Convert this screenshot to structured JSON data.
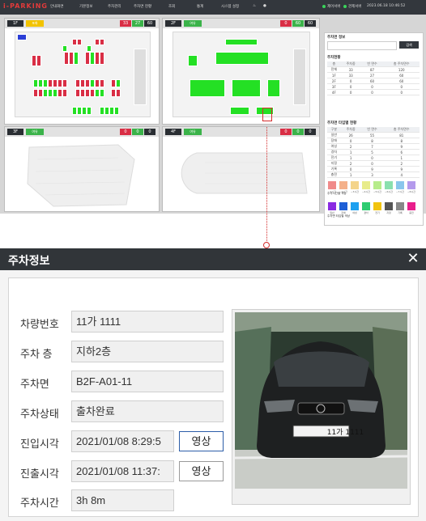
{
  "app": {
    "logo": "i-PARKING"
  },
  "menu": [
    "안내화면",
    "기본정보",
    "주차관리",
    "주차면 현황",
    "조회",
    "통계",
    "시스템 설정"
  ],
  "indicators": [
    "제어서버",
    "관제서버"
  ],
  "datetime": "2023.06.18 10:46:52",
  "floors": [
    {
      "label": "1F",
      "status": "포화",
      "status_color": "#f2c300",
      "counts": [
        "33",
        "27",
        "60"
      ]
    },
    {
      "label": "2F",
      "status": "여유",
      "status_color": "#3bb34a",
      "counts": [
        "0",
        "60",
        "60"
      ]
    },
    {
      "label": "3F",
      "status": "여유",
      "status_color": "#3bb34a",
      "counts": [
        "0",
        "0",
        "0"
      ]
    },
    {
      "label": "4F",
      "status": "여유",
      "status_color": "#3bb34a",
      "counts": [
        "0",
        "0",
        "0"
      ]
    }
  ],
  "side_panel": {
    "section1_title": "주차면 정보",
    "search_button": "검색",
    "section2_title": "주차현황",
    "status_table": {
      "headers": [
        "층",
        "주차중",
        "빈 면수",
        "총 주차면수"
      ],
      "rows": [
        [
          "전체",
          "33",
          "87",
          "120"
        ],
        [
          "1F",
          "33",
          "27",
          "60"
        ],
        [
          "2F",
          "0",
          "60",
          "60"
        ],
        [
          "3F",
          "0",
          "0",
          "0"
        ],
        [
          "4F",
          "0",
          "0",
          "0"
        ]
      ]
    },
    "section3_title": "주차면 타입별 현황",
    "type_table": {
      "headers": [
        "구분",
        "주차중",
        "빈 면수",
        "총 주차면수"
      ],
      "rows": [
        [
          "일반",
          "26",
          "55",
          "81"
        ],
        [
          "장애",
          "0",
          "8",
          "8"
        ],
        [
          "여성",
          "2",
          "7",
          "9"
        ],
        [
          "경차",
          "1",
          "5",
          "6"
        ],
        [
          "전기",
          "1",
          "0",
          "1"
        ],
        [
          "지정",
          "2",
          "0",
          "2"
        ],
        [
          "기록",
          "0",
          "9",
          "9"
        ],
        [
          "충전",
          "1",
          "3",
          "4"
        ]
      ]
    },
    "legend1_title": "주차시간별 색상",
    "legend1_colors": [
      "#f08a8a",
      "#f4b08a",
      "#f4d48a",
      "#e8ec8a",
      "#b6ec8a",
      "#8ae0ae",
      "#8ac6ec",
      "#b49aec"
    ],
    "legend1_labels": [
      "~1시간",
      "~2시간",
      "~3시간",
      "~4시간",
      "~5시간",
      "~6시간",
      "~7시간",
      "~8시간"
    ],
    "legend2_title": "주차면 타입별 색상",
    "legend2_colors": [
      "#8a2be2",
      "#1e5fd6",
      "#1ea0f0",
      "#2ecc71",
      "#f1c40f",
      "#555555",
      "#888888",
      "#e91e8c"
    ],
    "legend2_labels": [
      "일반",
      "장애",
      "여성",
      "경차",
      "전기",
      "지정",
      "기록",
      "충전"
    ]
  },
  "modal": {
    "title": "주차정보",
    "close_icon": "close-icon",
    "fields": {
      "plate_label": "차량번호",
      "plate_value": "11가 1111",
      "floor_label": "주차 층",
      "floor_value": "지하2층",
      "slot_label": "주차면",
      "slot_value": "B2F-A01-11",
      "state_label": "주차상태",
      "state_value": "출차완료",
      "entry_label": "진입시각",
      "entry_value": "2021/01/08 8:29:5",
      "exit_label": "진출시각",
      "exit_value": "2021/01/08 11:37:",
      "duration_label": "주차시간",
      "duration_value": "3h 8m"
    },
    "video_button_label": "영상",
    "photo_plate_text": "11가 1111"
  }
}
